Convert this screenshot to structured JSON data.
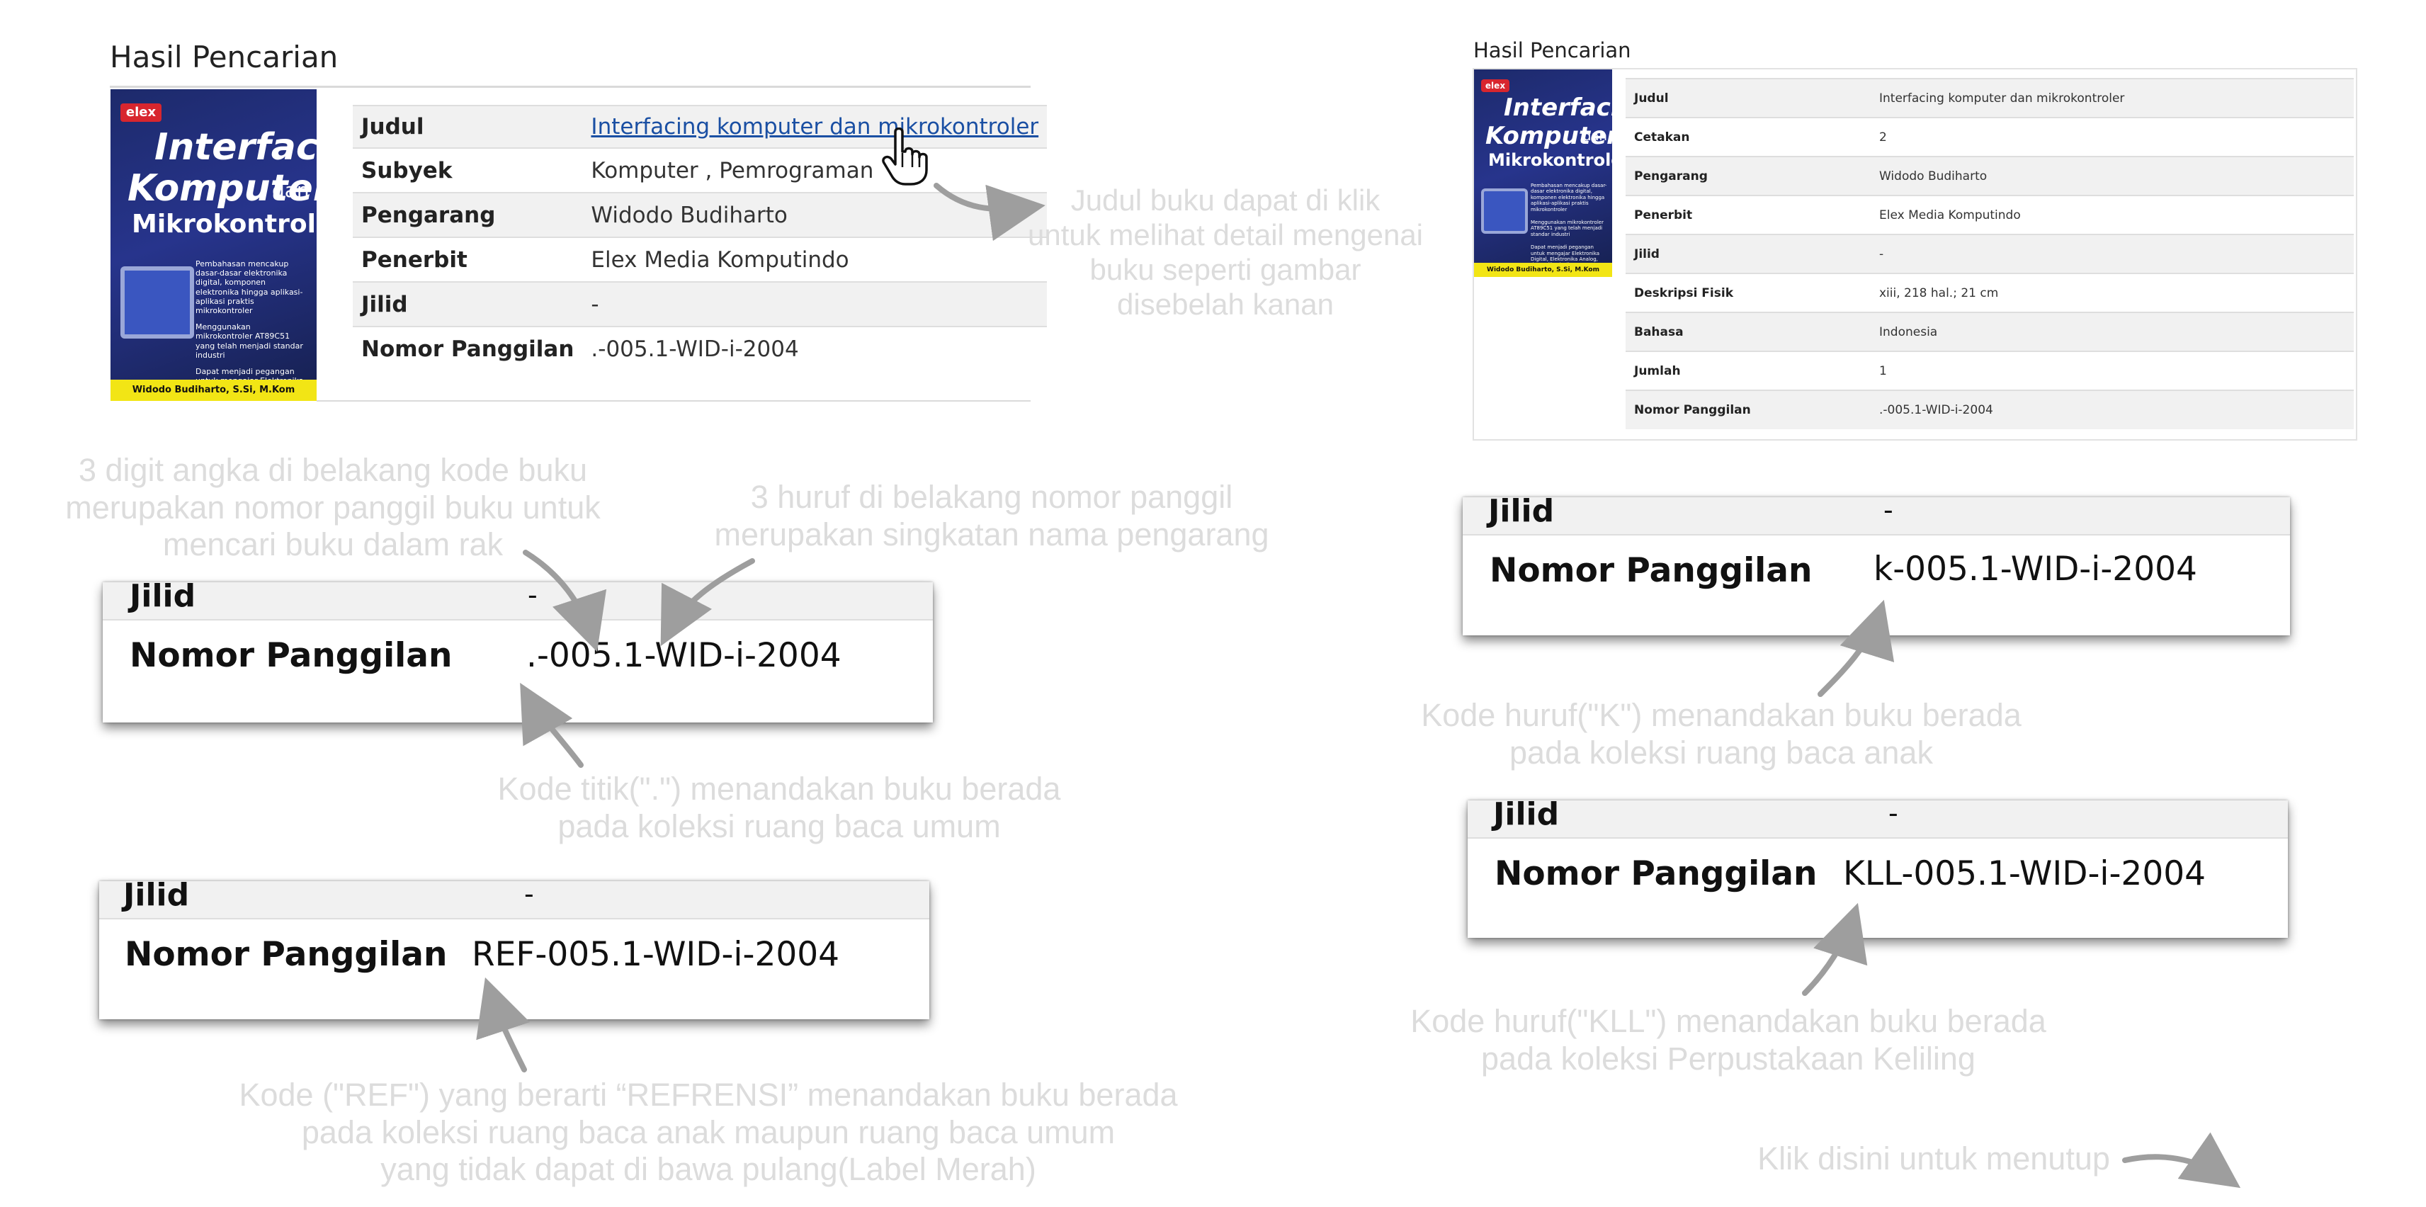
{
  "left_panel": {
    "title": "Hasil Pencarian",
    "cover": {
      "publisher_logo": "elex",
      "title_line1": "Interfacing",
      "title_line2": "Komputer",
      "title_line2b": "dan",
      "title_line3": "Mikrokontroler",
      "bullets": [
        "Pembahasan mencakup dasar-dasar elektronika digital, komponen elektronika hingga aplikasi-aplikasi praktis mikrokontroler",
        "Menggunakan mikrokontroler AT89C51 yang telah menjadi standar industri",
        "Dapat menjadi pegangan untuk mengajar Elektronika Digital, Elektronika Analog, dan Aplikasi Mikroprosesor"
      ],
      "author_band": "Widodo Budiharto, S.Si, M.Kom"
    },
    "rows": [
      {
        "key": "Judul",
        "value": "Interfacing komputer dan mikrokontroler"
      },
      {
        "key": "Subyek",
        "value": "Komputer , Pemrograman"
      },
      {
        "key": "Pengarang",
        "value": "Widodo Budiharto"
      },
      {
        "key": "Penerbit",
        "value": "Elex Media Komputindo"
      },
      {
        "key": "Jilid",
        "value": "-"
      },
      {
        "key": "Nomor Panggilan",
        "value": ".-005.1-WID-i-2004"
      }
    ]
  },
  "right_panel": {
    "title": "Hasil Pencarian",
    "rows": [
      {
        "key": "Judul",
        "value": "Interfacing komputer dan mikrokontroler"
      },
      {
        "key": "Cetakan",
        "value": "2"
      },
      {
        "key": "Pengarang",
        "value": "Widodo Budiharto"
      },
      {
        "key": "Penerbit",
        "value": "Elex Media Komputindo"
      },
      {
        "key": "Jilid",
        "value": "-"
      },
      {
        "key": "Deskripsi Fisik",
        "value": "xiii, 218 hal.; 21 cm"
      },
      {
        "key": "Bahasa",
        "value": "Indonesia"
      },
      {
        "key": "Jumlah",
        "value": "1"
      },
      {
        "key": "Nomor Panggilan",
        "value": ".-005.1-WID-i-2004"
      }
    ]
  },
  "notes": {
    "title_link": "Judul buku dapat di klik\nuntuk melihat detail mengenai\nbuku seperti gambar\ndisebelah kanan",
    "three_digit": "3 digit angka di belakang kode buku\nmerupakan nomor panggil buku untuk\nmencari buku dalam rak",
    "three_letter": "3 huruf di belakang nomor panggil\nmerupakan singkatan nama pengarang",
    "dot_code": "Kode titik(\".\") menandakan buku berada\npada koleksi ruang baca umum",
    "ref_code": "Kode (\"REF\") yang berarti “REFRENSI” menandakan buku berada\npada koleksi ruang baca anak maupun ruang baca umum\nyang tidak dapat di bawa pulang(Label Merah)",
    "k_code": "Kode huruf(\"K\") menandakan buku berada\npada koleksi ruang baca anak",
    "kll_code": "Kode huruf(\"KLL\") menandakan buku berada\npada koleksi Perpustakaan Keliling",
    "close": "Klik disini untuk menutup"
  },
  "cards": {
    "jilid_label": "Jilid",
    "jilid_value": "-",
    "call_label": "Nomor Panggilan",
    "dot": ".-005.1-WID-i-2004",
    "ref": "REF-005.1-WID-i-2004",
    "k": "k-005.1-WID-i-2004",
    "kll": "KLL-005.1-WID-i-2004"
  },
  "colors": {
    "link": "#1a4fa3",
    "note_text": "#dcdcdc",
    "cover_blue": "#27348c",
    "cover_band": "#f2e515"
  }
}
